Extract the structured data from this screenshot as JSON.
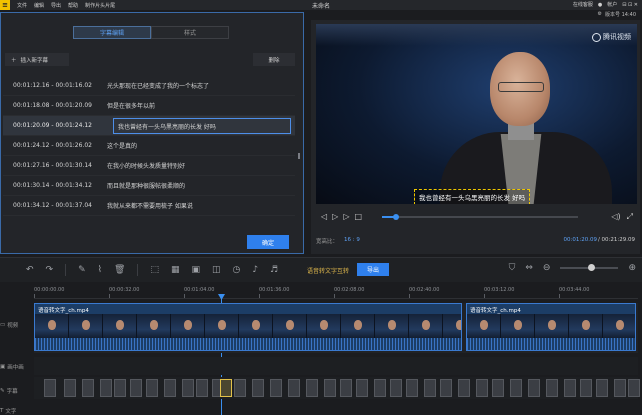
{
  "menu": {
    "logo": "≡",
    "items": [
      "文件",
      "编辑",
      "导出",
      "帮助",
      "制作片头片尾"
    ],
    "doc_title": "未命名",
    "right": {
      "online": "在线客服",
      "account": "帐户",
      "window": "⊟ ⊡ ✕"
    },
    "version": "版本号 14:40"
  },
  "subtitle_panel": {
    "tabs": [
      "字幕编辑",
      "样式"
    ],
    "insert_label": "插入新字幕",
    "delete_label": "删除",
    "confirm_label": "确定",
    "rows": [
      {
        "time": "00:01:12.16 - 00:01:16.02",
        "text": "光头那现在已经变成了我的一个标志了"
      },
      {
        "time": "00:01:18.08 - 00:01:20.09",
        "text": "但是在很多年以前"
      },
      {
        "time": "00:01:20.09 - 00:01:24.12",
        "text": "我也曾经有一头乌黑亮丽的长发 好吗"
      },
      {
        "time": "00:01:24.12 - 00:01:26.02",
        "text": "这个是真的"
      },
      {
        "time": "00:01:27.16 - 00:01:30.14",
        "text": "在我小的时候头发质量特别好"
      },
      {
        "time": "00:01:30.14 - 00:01:34.12",
        "text": "而且就是那种很服帖很柔顺的"
      },
      {
        "time": "00:01:34.12 - 00:01:37.04",
        "text": "我就从来都不需要用梳子 如果说"
      }
    ],
    "selected_index": 2
  },
  "preview": {
    "watermark": "腾讯视频",
    "subtitle_overlay": "我也曾经有一头乌黑亮丽的长发 好吗",
    "progress": 0.07,
    "ratio_label": "宽高比：",
    "ratio_value": "16 : 9",
    "time_current": "00:01:20.09",
    "time_total": "/ 00:21:29.09"
  },
  "toolbar": {
    "speech_to_text": "语音转文字互转",
    "export": "导出",
    "zoom_level": 0.52
  },
  "timeline": {
    "ticks": [
      "00:00:00.00",
      "00:00:32.00",
      "00:01:04.00",
      "00:01:36.00",
      "00:02:08.00",
      "00:02:40.00",
      "00:03:12.00",
      "00:03:44.00"
    ],
    "tracks": [
      "视频",
      "画中画",
      "字幕",
      "文字"
    ],
    "clip_name": "语音转文字_ch.mp4",
    "playhead_fraction": 0.312
  }
}
